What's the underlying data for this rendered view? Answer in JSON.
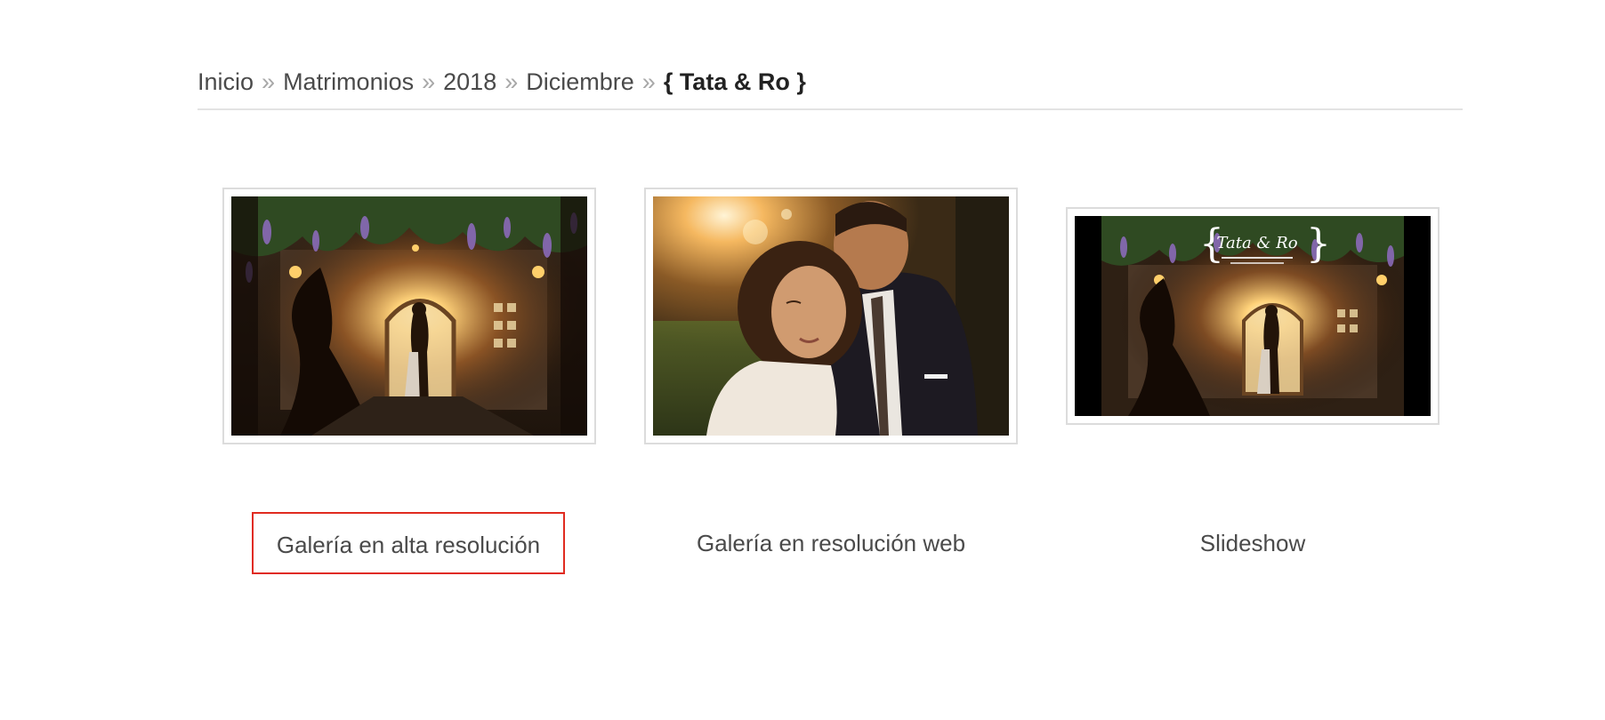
{
  "breadcrumb": {
    "items": [
      {
        "label": "Inicio"
      },
      {
        "label": "Matrimonios"
      },
      {
        "label": "2018"
      },
      {
        "label": "Diciembre"
      }
    ],
    "separator": "»",
    "current": "{ Tata & Ro }"
  },
  "gallery": {
    "items": [
      {
        "label": "Galería en alta resolución",
        "thumbnail": "couple-under-wisteria-arch-photo",
        "highlighted": true
      },
      {
        "label": "Galería en resolución web",
        "thumbnail": "couple-embrace-sunset-photo",
        "highlighted": false
      },
      {
        "label": "Slideshow",
        "thumbnail": "slideshow-title-frame-photo",
        "highlighted": false
      }
    ],
    "slideshow_title": "Tata & Ro"
  },
  "colors": {
    "text": "#4a4a4a",
    "separator": "#a8a8a8",
    "rule": "#e3e3e3",
    "highlight_border": "#e02b20",
    "thumb_border": "#dcdcdc"
  }
}
